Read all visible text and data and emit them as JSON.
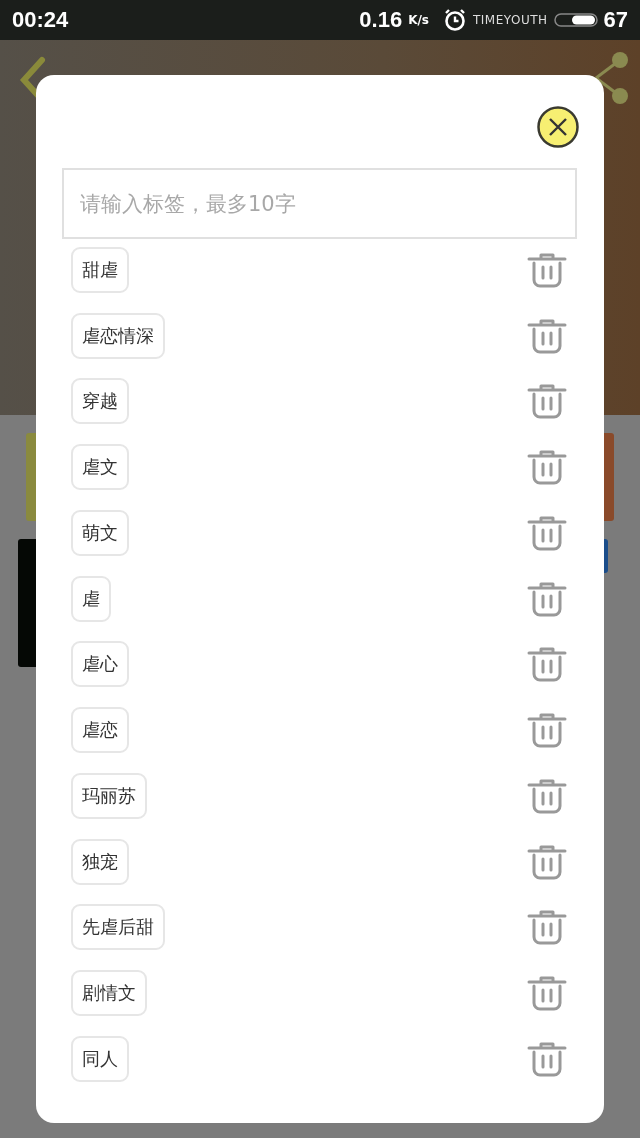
{
  "status_bar": {
    "time": "00:24",
    "speed": "0.16",
    "speed_unit": "K/s",
    "notification": "TIMEYOUTH",
    "battery": "67"
  },
  "dialog": {
    "input": {
      "placeholder": "请输入标签，最多10字"
    },
    "tags": [
      {
        "label": "甜虐"
      },
      {
        "label": "虐恋情深"
      },
      {
        "label": "穿越"
      },
      {
        "label": "虐文"
      },
      {
        "label": "萌文"
      },
      {
        "label": "虐"
      },
      {
        "label": "虐心"
      },
      {
        "label": "虐恋"
      },
      {
        "label": "玛丽苏"
      },
      {
        "label": "独宠"
      },
      {
        "label": "先虐后甜"
      },
      {
        "label": "剧情文"
      },
      {
        "label": "同人"
      }
    ]
  }
}
